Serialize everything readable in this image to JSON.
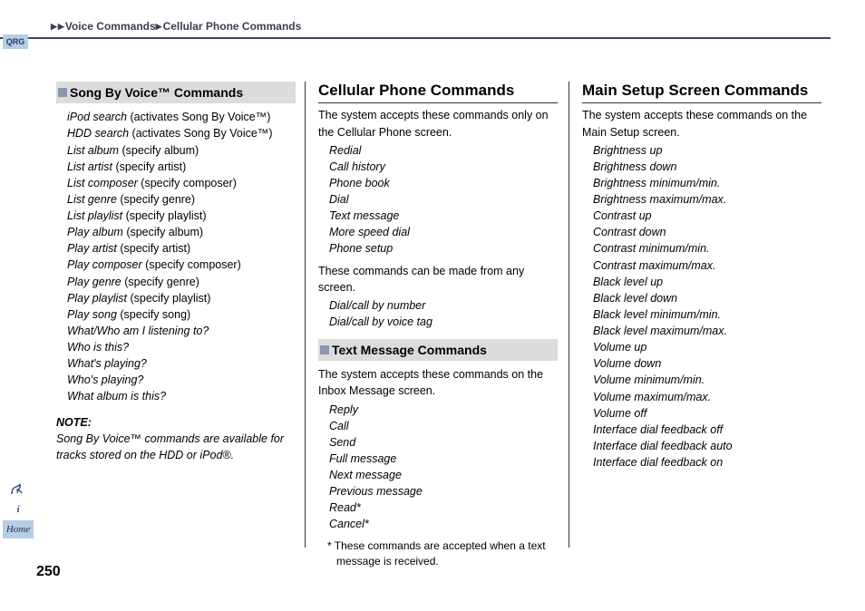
{
  "header": {
    "crumb1": "Voice Commands",
    "crumb2": "Cellular Phone Commands"
  },
  "qrg": "QRG",
  "pageNumber": "250",
  "col1": {
    "sectionTitle": "Song By Voice™ Commands",
    "items": [
      {
        "cmd": "iPod search",
        "note": " (activates Song By Voice™)"
      },
      {
        "cmd": "HDD search",
        "note": " (activates Song By Voice™)"
      },
      {
        "cmd": "List album",
        "note": " (specify album)"
      },
      {
        "cmd": "List artist",
        "note": " (specify artist)"
      },
      {
        "cmd": "List composer",
        "note": " (specify composer)"
      },
      {
        "cmd": "List genre",
        "note": " (specify genre)"
      },
      {
        "cmd": "List playlist",
        "note": " (specify playlist)"
      },
      {
        "cmd": "Play album",
        "note": " (specify album)"
      },
      {
        "cmd": "Play artist",
        "note": " (specify artist)"
      },
      {
        "cmd": "Play composer",
        "note": " (specify composer)"
      },
      {
        "cmd": "Play genre",
        "note": " (specify genre)"
      },
      {
        "cmd": "Play playlist",
        "note": " (specify playlist)"
      },
      {
        "cmd": "Play song",
        "note": " (specify song)"
      },
      {
        "cmd": "What/Who am I listening to?",
        "note": ""
      },
      {
        "cmd": "Who is this?",
        "note": ""
      },
      {
        "cmd": "What's playing?",
        "note": ""
      },
      {
        "cmd": "Who's playing?",
        "note": ""
      },
      {
        "cmd": "What album is this?",
        "note": ""
      }
    ],
    "noteLabel": "NOTE:",
    "noteText": "Song By Voice™ commands are available for tracks stored on the HDD or iPod®."
  },
  "col2": {
    "heading": "Cellular Phone Commands",
    "intro": "The system accepts these commands only on the Cellular Phone screen.",
    "list1": [
      "Redial",
      "Call history",
      "Phone book",
      "Dial",
      "Text message",
      "More speed dial",
      "Phone setup"
    ],
    "midText": "These commands can be made from any screen.",
    "list2": [
      "Dial/call by number",
      "Dial/call by voice tag"
    ],
    "subSectionTitle": "Text Message Commands",
    "subIntro": "The system accepts these commands on the Inbox Message screen.",
    "list3": [
      "Reply",
      "Call",
      "Send",
      "Full message",
      "Next message",
      "Previous message",
      "Read*",
      "Cancel*"
    ],
    "footnote": "*  These commands are accepted when a text message is received."
  },
  "col3": {
    "heading": "Main Setup Screen Commands",
    "intro": "The system accepts these commands on the Main Setup screen.",
    "list": [
      "Brightness up",
      "Brightness down",
      "Brightness minimum/min.",
      "Brightness maximum/max.",
      "Contrast up",
      "Contrast down",
      "Contrast minimum/min.",
      "Contrast maximum/max.",
      "Black level up",
      "Black level down",
      "Black level minimum/min.",
      "Black level maximum/max.",
      "Volume up",
      "Volume down",
      "Volume minimum/min.",
      "Volume maximum/max.",
      "Volume off",
      "Interface dial feedback off",
      "Interface dial feedback auto",
      "Interface dial feedback on"
    ]
  },
  "icons": {
    "home": "Home"
  }
}
